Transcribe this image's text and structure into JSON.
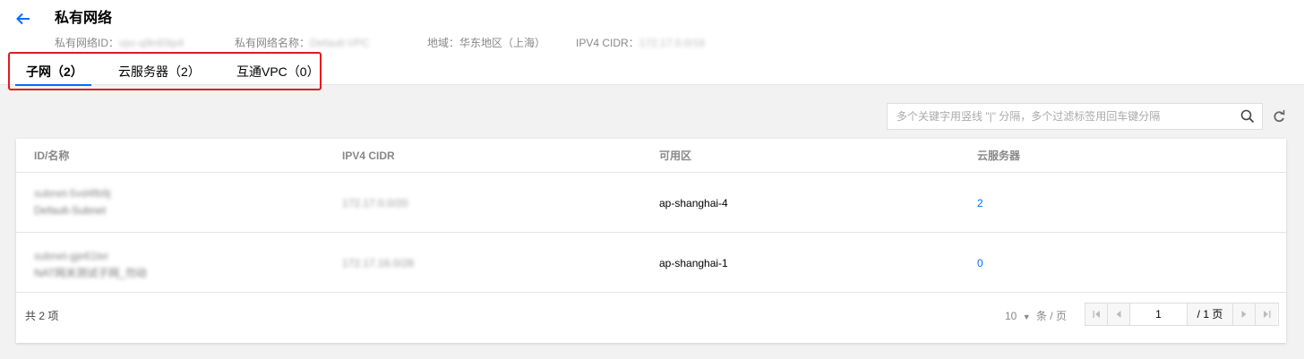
{
  "header": {
    "title": "私有网络",
    "meta": {
      "vpc_id_label": "私有网络ID：",
      "vpc_id_value": "vpc-q9n93ip4",
      "vpc_name_label": "私有网络名称：",
      "vpc_name_value": "Default-VPC",
      "region_label": "地域：",
      "region_value": "华东地区（上海）",
      "cidr_label": "IPV4 CIDR：",
      "cidr_value": "172.17.0.0/16"
    }
  },
  "tabs": [
    {
      "label": "子网（2）",
      "active": true
    },
    {
      "label": "云服务器（2）",
      "active": false
    },
    {
      "label": "互通VPC（0）",
      "active": false
    }
  ],
  "search": {
    "placeholder": "多个关键字用竖线 \"|\" 分隔，多个过滤标签用回车键分隔"
  },
  "table": {
    "columns": [
      "ID/名称",
      "IPV4 CIDR",
      "可用区",
      "云服务器"
    ],
    "rows": [
      {
        "id": "subnet-5vd4fb9j",
        "name": "Default-Subnet",
        "cidr": "172.17.0.0/20",
        "zone": "ap-shanghai-4",
        "servers": "2"
      },
      {
        "id": "subnet-gje61ter",
        "name": "NAT网关测试子网_勿动",
        "cidr": "172.17.16.0/28",
        "zone": "ap-shanghai-1",
        "servers": "0"
      }
    ]
  },
  "footer": {
    "total": "共 2 项",
    "page_size": "10",
    "page_size_unit": "条 / 页",
    "current_page": "1",
    "total_pages": "/ 1 页"
  },
  "colors": {
    "accent": "#006eff",
    "highlight_box": "#e5191c"
  }
}
